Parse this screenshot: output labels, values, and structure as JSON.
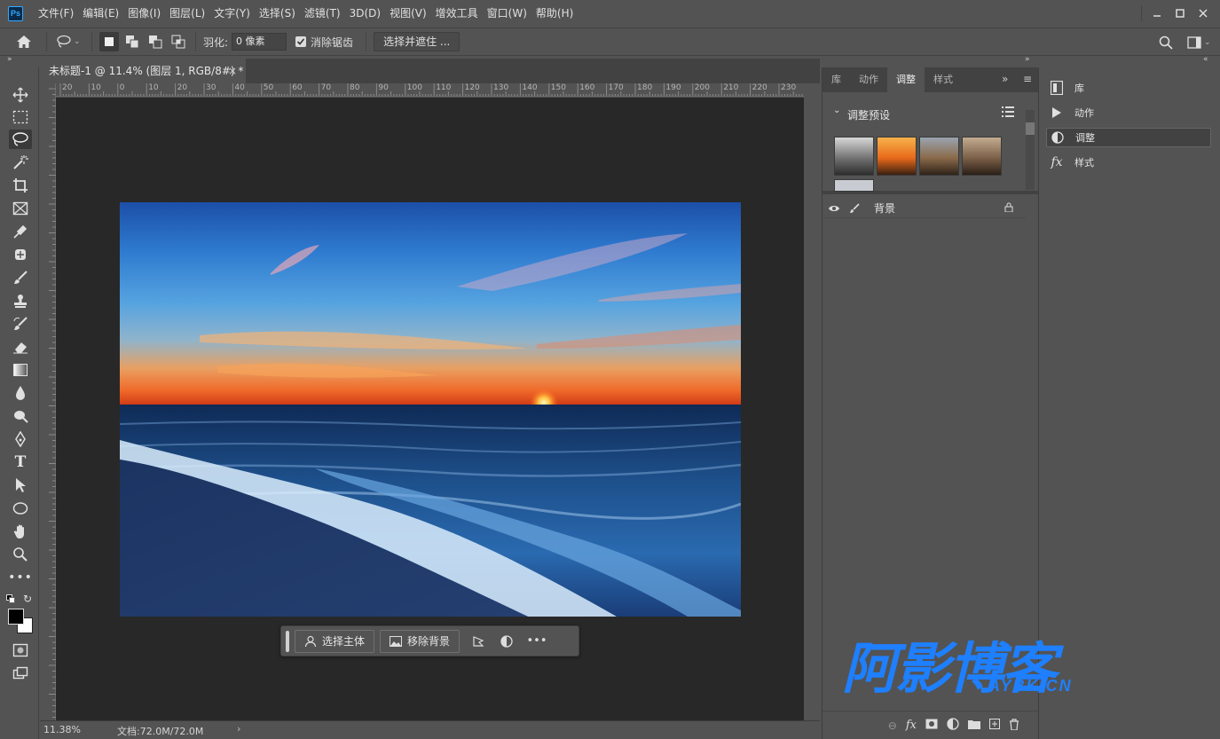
{
  "app": {
    "logo_text": "Ps",
    "accent": "#31a8ff"
  },
  "menu": [
    "文件(F)",
    "编辑(E)",
    "图像(I)",
    "图层(L)",
    "文字(Y)",
    "选择(S)",
    "滤镜(T)",
    "3D(D)",
    "视图(V)",
    "增效工具",
    "窗口(W)",
    "帮助(H)"
  ],
  "options": {
    "feather_label": "羽化:",
    "feather_value": "0 像素",
    "antialias_label": "消除锯齿",
    "antialias_checked": true,
    "select_mask_label": "选择并遮住 ..."
  },
  "document": {
    "tab_title": "未标题-1 @ 11.4% (图层 1, RGB/8#) *",
    "ruler_labels": [
      "20",
      "10",
      "0",
      "10",
      "20",
      "30",
      "40",
      "50",
      "60",
      "70",
      "80",
      "90",
      "100",
      "110",
      "120",
      "130",
      "140",
      "150",
      "160",
      "170",
      "180",
      "190",
      "200",
      "210",
      "220",
      "230"
    ],
    "zoom": "11.38%",
    "doc_info": "文档:72.0M/72.0M"
  },
  "context_bar": {
    "select_subject": "选择主体",
    "remove_background": "移除背景"
  },
  "panels": {
    "tabs": [
      "库",
      "动作",
      "调整",
      "样式"
    ],
    "active_tab": "调整",
    "adjust_presets_title": "调整预设",
    "layer_name": "背景"
  },
  "side_dock": {
    "items": [
      "库",
      "动作",
      "调整",
      "样式"
    ],
    "active": "调整"
  },
  "watermark": {
    "cn": "阿影博客",
    "en": "AYBK.CN"
  }
}
